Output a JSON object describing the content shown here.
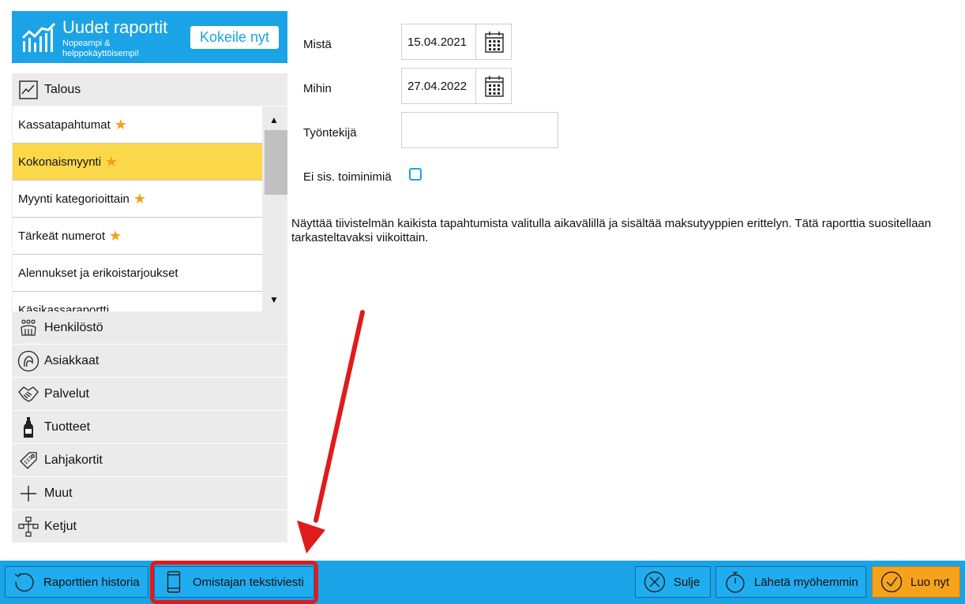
{
  "banner": {
    "title": "Uudet raportit",
    "subtitle": "Nopeampi & helppokäyttöisempi!",
    "button_label": "Kokeile nyt"
  },
  "sidebar": {
    "top_category": {
      "label": "Talous",
      "icon": "line-chart-icon"
    },
    "report_items": [
      {
        "label": "Kassatapahtumat",
        "starred": true,
        "selected": false
      },
      {
        "label": "Kokonaismyynti",
        "starred": true,
        "selected": true
      },
      {
        "label": "Myynti kategorioittain",
        "starred": true,
        "selected": false
      },
      {
        "label": "Tärkeät numerot",
        "starred": true,
        "selected": false
      },
      {
        "label": "Alennukset ja erikoistarjoukset",
        "starred": false,
        "selected": false
      },
      {
        "label": "Käsikassaraportti",
        "starred": false,
        "selected": false
      }
    ],
    "star_glyph": "★",
    "scroll_up": "▲",
    "scroll_down": "▼",
    "categories": [
      {
        "label": "Henkilöstö",
        "icon": "staff-icon"
      },
      {
        "label": "Asiakkaat",
        "icon": "customer-icon"
      },
      {
        "label": "Palvelut",
        "icon": "handshake-icon"
      },
      {
        "label": "Tuotteet",
        "icon": "bottle-icon"
      },
      {
        "label": "Lahjakortit",
        "icon": "gift-tag-icon"
      },
      {
        "label": "Muut",
        "icon": "plus-icon"
      },
      {
        "label": "Ketjut",
        "icon": "network-icon"
      }
    ]
  },
  "form": {
    "from_label": "Mistä",
    "from_value": "15.04.2021",
    "to_label": "Mihin",
    "to_value": "27.04.2022",
    "employee_label": "Työntekijä",
    "employee_value": "",
    "exclude_label": "Ei sis. toiminimiä",
    "exclude_checked": false
  },
  "description": "Näyttää tiivistelmän kaikista tapahtumista valitulla aikavälillä ja sisältää maksutyyppien erittelyn. Tätä raporttia suositellaan tarkasteltavaksi viikoittain.",
  "footer": {
    "history_label": "Raporttien historia",
    "sms_label": "Omistajan tekstiviesti",
    "close_label": "Sulje",
    "send_later_label": "Lähetä myöhemmin",
    "create_label": "Luo nyt"
  },
  "colors": {
    "accent": "#1aa3e6",
    "selected_row": "#fad84a",
    "star": "#f2a019",
    "primary_button": "#f7a21b",
    "annotation": "#e01b1b"
  }
}
